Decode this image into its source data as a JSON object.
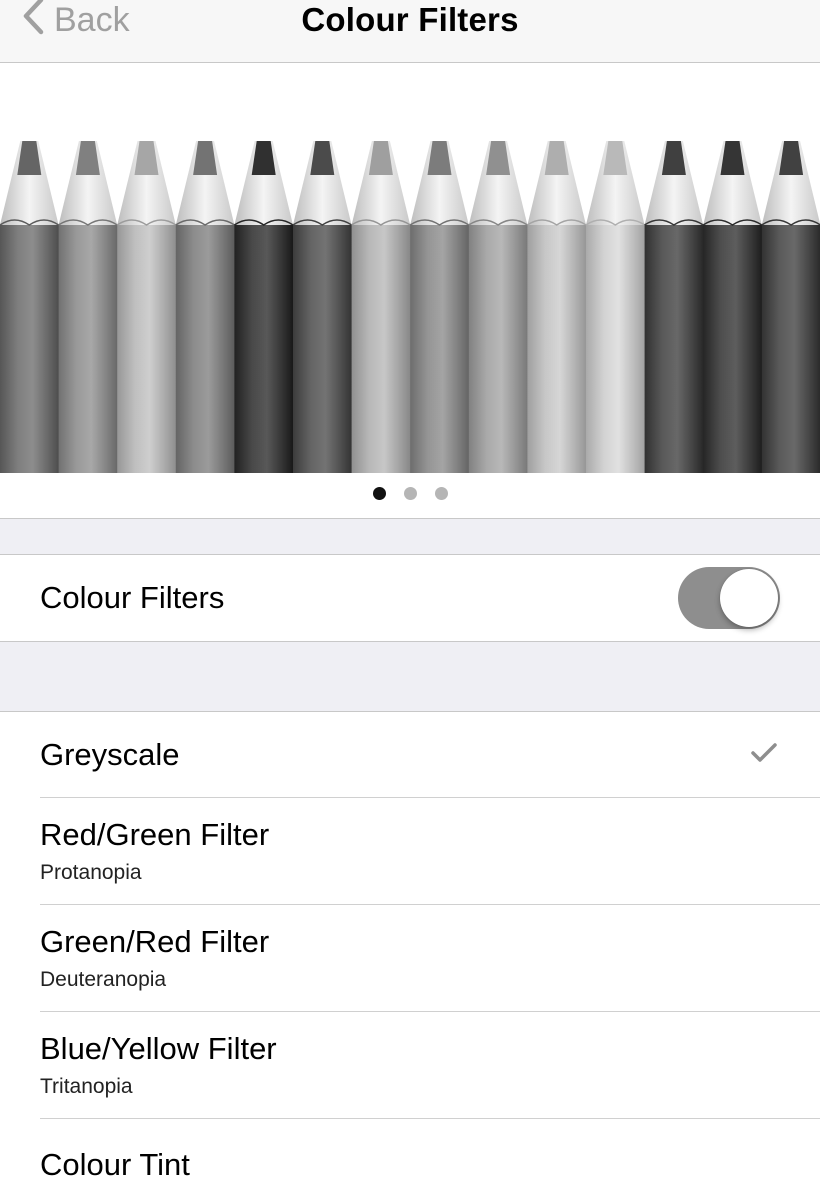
{
  "nav": {
    "back_label": "Back",
    "title": "Colour Filters"
  },
  "preview": {
    "page_count": 3,
    "current_page": 1,
    "pencil_shades": [
      "#6f6f6f",
      "#8a8a8a",
      "#b0b0b0",
      "#7d7d7d",
      "#3a3a3a",
      "#555555",
      "#a9a9a9",
      "#868686",
      "#9a9a9a",
      "#b8b8b8",
      "#c3c3c3",
      "#4a4a4a",
      "#3f3f3f",
      "#4b4b4b"
    ]
  },
  "colour_filters_toggle": {
    "label": "Colour Filters",
    "on": true
  },
  "filters": [
    {
      "title": "Greyscale",
      "subtitle": "",
      "selected": true
    },
    {
      "title": "Red/Green Filter",
      "subtitle": "Protanopia",
      "selected": false
    },
    {
      "title": "Green/Red Filter",
      "subtitle": "Deuteranopia",
      "selected": false
    },
    {
      "title": "Blue/Yellow Filter",
      "subtitle": "Tritanopia",
      "selected": false
    },
    {
      "title": "Colour Tint",
      "subtitle": "",
      "selected": false
    }
  ],
  "colors": {
    "nav_bg": "#f7f7f7",
    "back_tint": "#a0a0a0",
    "toggle_on": "#8e8e8e",
    "checkmark": "#8e8e8e",
    "group_bg": "#efeff4"
  },
  "icons": {
    "back": "chevron-left-icon",
    "selected": "checkmark-icon"
  }
}
